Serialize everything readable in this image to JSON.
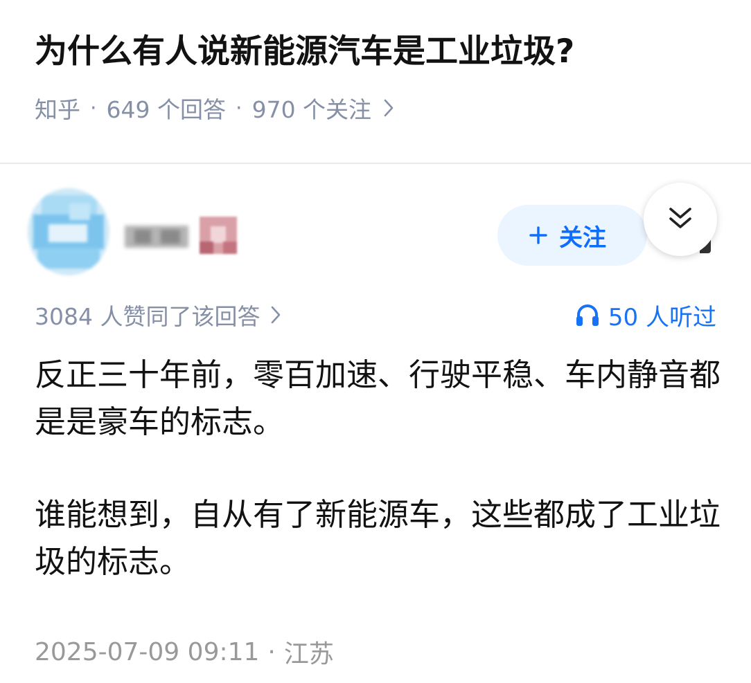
{
  "question": {
    "title": "为什么有人说新能源汽车是工业垃圾?",
    "source": "知乎",
    "answer_count": "649 个回答",
    "follower_count": "970 个关注"
  },
  "author": {
    "follow_label": "关注"
  },
  "answer": {
    "vote_summary": "3084 人赞同了该回答",
    "listen_count": "50 人听过",
    "paragraphs": [
      "反正三十年前，零百加速、行驶平稳、车内静音都是是豪车的标志。",
      "谁能想到，自从有了新能源车，这些都成了工业垃圾的标志。"
    ],
    "timestamp": "2025-07-09 09:11",
    "location": "江苏"
  },
  "colors": {
    "accent": "#1772f6",
    "follow_bg": "#ebf5ff",
    "meta_text": "#8590a6"
  },
  "icons": [
    "chevron-right-icon",
    "plus-icon",
    "double-chevron-down-icon",
    "headphone-icon"
  ]
}
